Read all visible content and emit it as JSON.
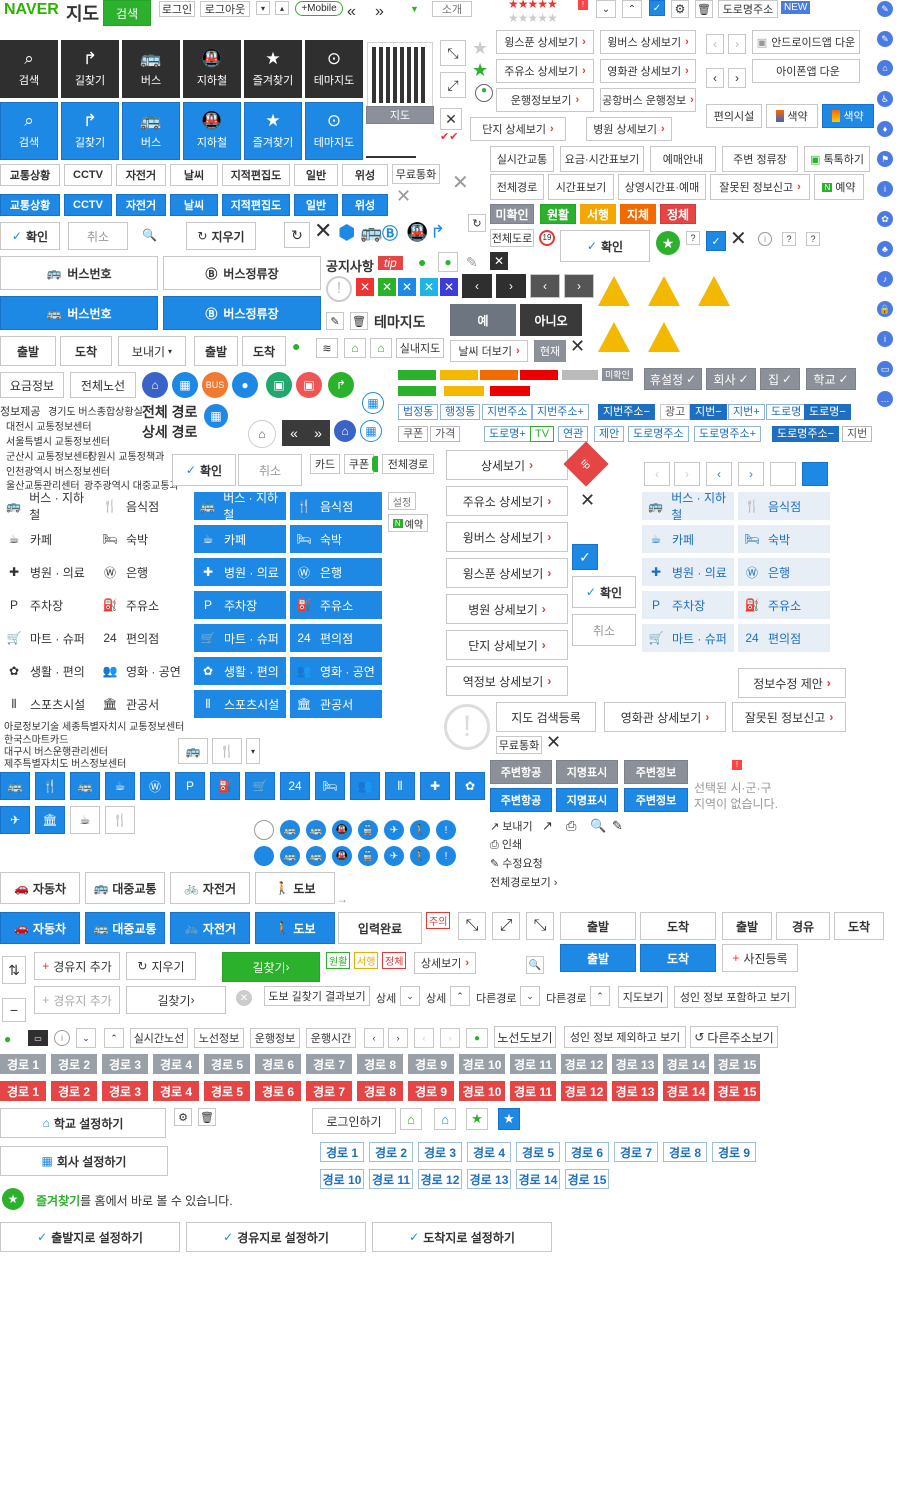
{
  "brand": {
    "naver": "NAVER",
    "map": "지도",
    "search": "검색"
  },
  "top": {
    "login": "로그인",
    "logout": "로그아웃",
    "mobile": "+Mobile",
    "intro": "소개",
    "roadAddr": "도로명주소",
    "new": "NEW"
  },
  "nav": [
    "검색",
    "길찾기",
    "버스",
    "지하철",
    "즐겨찾기",
    "테마지도"
  ],
  "navIcons": [
    "search-icon",
    "route-icon",
    "bus-icon",
    "subway-icon",
    "star-icon",
    "pin-icon"
  ],
  "qrLabel": "지도",
  "tabs": [
    "교통상황",
    "CCTV",
    "자전거",
    "날씨",
    "지적편집도",
    "일반",
    "위성"
  ],
  "freeCall": "무료통화",
  "confirm": "확인",
  "cancel": "취소",
  "erase": "지우기",
  "busNumber": "버스번호",
  "busStop": "버스정류장",
  "notice": "공지사항",
  "tip": "tip",
  "themeMap": "테마지도",
  "yes": "예",
  "no": "아니오",
  "depart": "출발",
  "arrive": "도착",
  "sendTo": "보내기",
  "indoor": "실내지도",
  "moreWeather": "날씨 더보기",
  "current": "현재",
  "fareInfo": "요금정보",
  "allRoutes": "전체노선",
  "roundIcons": [
    "BUS"
  ],
  "traffic": {
    "info": "정보제공",
    "ggbus": "경기도 버스종합상황실",
    "djtraffic": "대전시 교통정보센터",
    "seoul": "서울특별시 교통정보센터",
    "gunsan": "군산시 교통정보센터",
    "changwon": "창원시 교통정책과",
    "incheon": "인천광역시 버스정보센터",
    "ulsan": "울산교통관리센터",
    "gwangju": "광주광역시 대중교통과",
    "aro": "아로정보기술",
    "sejong": "세종특별자치시 교통정보센터",
    "kscard": "한국스마트카드",
    "daegu": "대구시 버스운행관리센터",
    "jeju": "제주특별자치도 버스정보센터"
  },
  "fullRoute": "전체 경로",
  "detailRoute": "상세 경로",
  "card": "카드",
  "coupon": "쿠폰",
  "fullPath": "전체경로",
  "detailView": "상세보기",
  "categories": [
    "버스 · 지하철",
    "음식점",
    "카페",
    "숙박",
    "병원 · 의료",
    "은행",
    "주차장",
    "주유소",
    "마트 · 슈퍼",
    "편의점",
    "생활 · 편의",
    "영화 · 공연",
    "스포츠시설",
    "관공서"
  ],
  "catIcons": [
    "bus-icon",
    "fork-icon",
    "cafe-icon",
    "bed-icon",
    "hospital-icon",
    "bank-icon",
    "parking-icon",
    "gas-icon",
    "cart-icon",
    "store24-icon",
    "plant-icon",
    "people-icon",
    "sports-icon",
    "government-icon"
  ],
  "setting": "설정",
  "reserve": "예약",
  "details": [
    "주유소 상세보기",
    "윙버스 상세보기",
    "윙스푼 상세보기",
    "병원 상세보기",
    "단지 상세보기",
    "역정보 상세보기"
  ],
  "topDetails": [
    [
      "윙스푼 상세보기",
      "윙버스 상세보기"
    ],
    [
      "주유소 상세보기",
      "영화관 상세보기"
    ],
    [
      "운행정보보기",
      "공항버스 운행정보"
    ],
    [
      "단지 상세보기",
      "병원 상세보기"
    ]
  ],
  "apps": [
    "안드로이드앱 다운",
    "아이폰앱 다운"
  ],
  "convenience": "편의시설",
  "color": "색약",
  "transitTabs": [
    "실시간교통",
    "요금·시간표보기",
    "예매안내",
    "주변 정류장",
    "톡톡하기"
  ],
  "transitTabs2": [
    "전체경로",
    "시간표보기",
    "상영시간표·예매",
    "잘못된 정보신고",
    "예약"
  ],
  "status": [
    "미확인",
    "원활",
    "서행",
    "지체",
    "정체"
  ],
  "fullRoad": "전체도로",
  "tags": {
    "holiday": "휴설정",
    "company": "회사",
    "home": "집",
    "school": "학교",
    "legal": "법정동",
    "admin": "행정동",
    "lot": "지번주소",
    "lotPlus": "지번주소+",
    "lotMinus": "지번주소−",
    "ad": "광고",
    "jibun": "지번",
    "road": "도로명",
    "tv": "TV",
    "link": "연관",
    "suggest": "제안",
    "roadAddr": "도로명주소",
    "coupon": "쿠폰",
    "price": "가격",
    "roadPlus": "도로명+",
    "jibun2": "지번"
  },
  "infoEdit": "정보수정 제안",
  "mapSearchReg": "지도 검색등록",
  "cinemaDetail": "영화관 상세보기",
  "wrongReport": "잘못된 정보신고",
  "aroundTabs": [
    "주변항공",
    "지명표시",
    "주변정보"
  ],
  "noRegion": "선택된 시·군·구\n지역이 없습니다.",
  "actions": [
    "보내기",
    "인쇄",
    "수정요청",
    "전체경로보기"
  ],
  "modes": [
    "자동차",
    "대중교통",
    "자전거",
    "도보"
  ],
  "inputDone": "입력완료",
  "caution": "주의",
  "waypoint": "경유",
  "addPhoto": "사진등록",
  "addWaypoint": "경유지 추가",
  "findRoute": "길찾기",
  "trafficLabels": [
    "원활",
    "서행",
    "정체"
  ],
  "walkResult": "도보 길찾기 결과보기",
  "detail": "상세",
  "otherRoute": "다른경로",
  "mapView": "지도보기",
  "adultInfo": "성인 정보 포함하고 보기",
  "realtimeLine": "실시간노선",
  "lineInfo": "노선정보",
  "runInfo": "운행정보",
  "runTime": "운행시간",
  "lineView": "노선도보기",
  "adultExclude": "성인 정보 제외하고 보기",
  "otherAddr": "다른주소보기",
  "routes": [
    "경로 1",
    "경로 2",
    "경로 3",
    "경로 4",
    "경로 5",
    "경로 6",
    "경로 7",
    "경로 8",
    "경로 9",
    "경로 10",
    "경로 11",
    "경로 12",
    "경로 13",
    "경로 14",
    "경로 15"
  ],
  "schoolSet": "학교 설정하기",
  "companySet": "회사 설정하기",
  "loginBtn": "로그인하기",
  "favNotice": "즐겨찾기",
  "favNoticeRest": "를 홈에서 바로 볼 수 있습니다.",
  "setDepart": "출발지로 설정하기",
  "setWaypoint": "경유지로 설정하기",
  "setArrive": "도착지로 설정하기",
  "colors": {
    "blue": "#1e88e5",
    "dark": "#2f2f2f",
    "green": "#2cb12c",
    "red": "#e64545",
    "gray": "#8b9099"
  }
}
